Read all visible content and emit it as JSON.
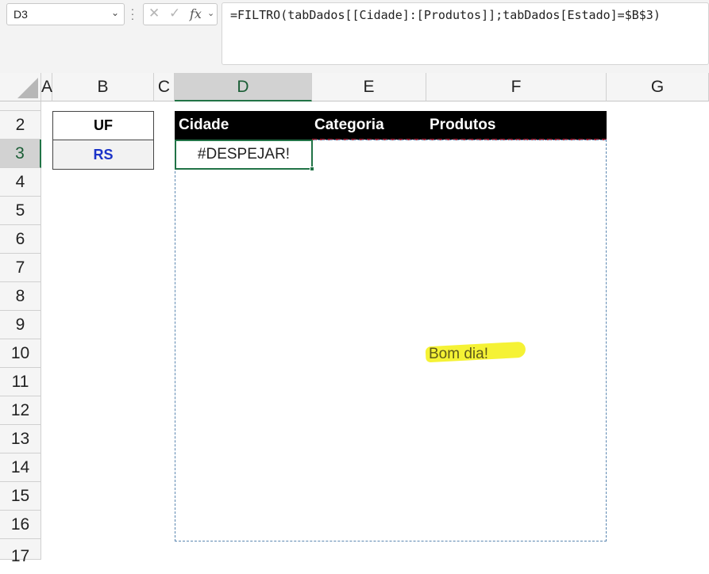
{
  "formula_bar": {
    "name_box": "D3",
    "formula": "=FILTRO(tabDados[[Cidade]:[Produtos]];tabDados[Estado]=$B$3)",
    "fx_label": "fx"
  },
  "columns": [
    "A",
    "B",
    "C",
    "D",
    "E",
    "F",
    "G"
  ],
  "rows": [
    "2",
    "3",
    "4",
    "5",
    "6",
    "7",
    "8",
    "9",
    "10",
    "11",
    "12",
    "13",
    "14",
    "15",
    "16",
    "17"
  ],
  "cells": {
    "uf_label": "UF",
    "uf_value": "RS",
    "table_headers": [
      "Cidade",
      "Categoria",
      "Produtos"
    ],
    "error": "#DESPEJAR!",
    "note": "Bom dia!"
  },
  "colors": {
    "selection": "#217346",
    "uf_value": "#1b33c8",
    "header_bg": "#000000",
    "highlight": "#f4f12a"
  }
}
